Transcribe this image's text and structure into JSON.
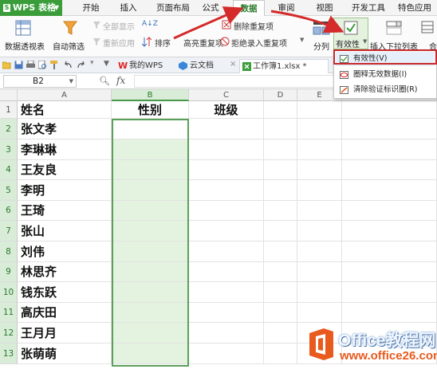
{
  "app": {
    "name": "WPS 表格"
  },
  "menu_tabs": [
    "开始",
    "插入",
    "页面布局",
    "公式",
    "数据",
    "审阅",
    "视图",
    "开发工具",
    "特色应用"
  ],
  "ribbon": {
    "pivot": "数据透视表",
    "autofilter": "自动筛选",
    "show_all": "全部显示",
    "reapply": "重新应用",
    "sort_az": "A↓Z",
    "sort": "排序",
    "highlight_dup": "高亮重复项",
    "remove_dup": "删除重复项",
    "reject_dup": "拒绝录入重复项",
    "split": "分列",
    "validity": "有效性",
    "dropdown_list": "插入下拉列表",
    "merge_calc": "合"
  },
  "validity_menu": [
    "有效性(V)",
    "圈释无效数据(I)",
    "清除验证标识圈(R)"
  ],
  "doc_tabs": [
    "我的WPS",
    "云文档",
    "工作簿1.xlsx *"
  ],
  "formula_bar": {
    "name_box": "B2",
    "fx": "fx",
    "value": ""
  },
  "columns": [
    "A",
    "B",
    "C",
    "D",
    "E"
  ],
  "rows": [
    "1",
    "2",
    "3",
    "4",
    "5",
    "6",
    "7",
    "8",
    "9",
    "10",
    "11",
    "12",
    "13"
  ],
  "sheet": {
    "header": {
      "name": "姓名",
      "gender": "性别",
      "class": "班级"
    },
    "names": [
      "张文孝",
      "李琳琳",
      "王友良",
      "李明",
      "王琦",
      "张山",
      "刘伟",
      "林思齐",
      "钱东跃",
      "高庆田",
      "王月月",
      "张萌萌"
    ]
  },
  "watermark": {
    "title": "Office教程网",
    "url": "www.office26.com"
  },
  "colors": {
    "accent_green": "#3a9d3a",
    "selection_fill": "#e3f3df",
    "highlight_red": "#c8282c"
  }
}
